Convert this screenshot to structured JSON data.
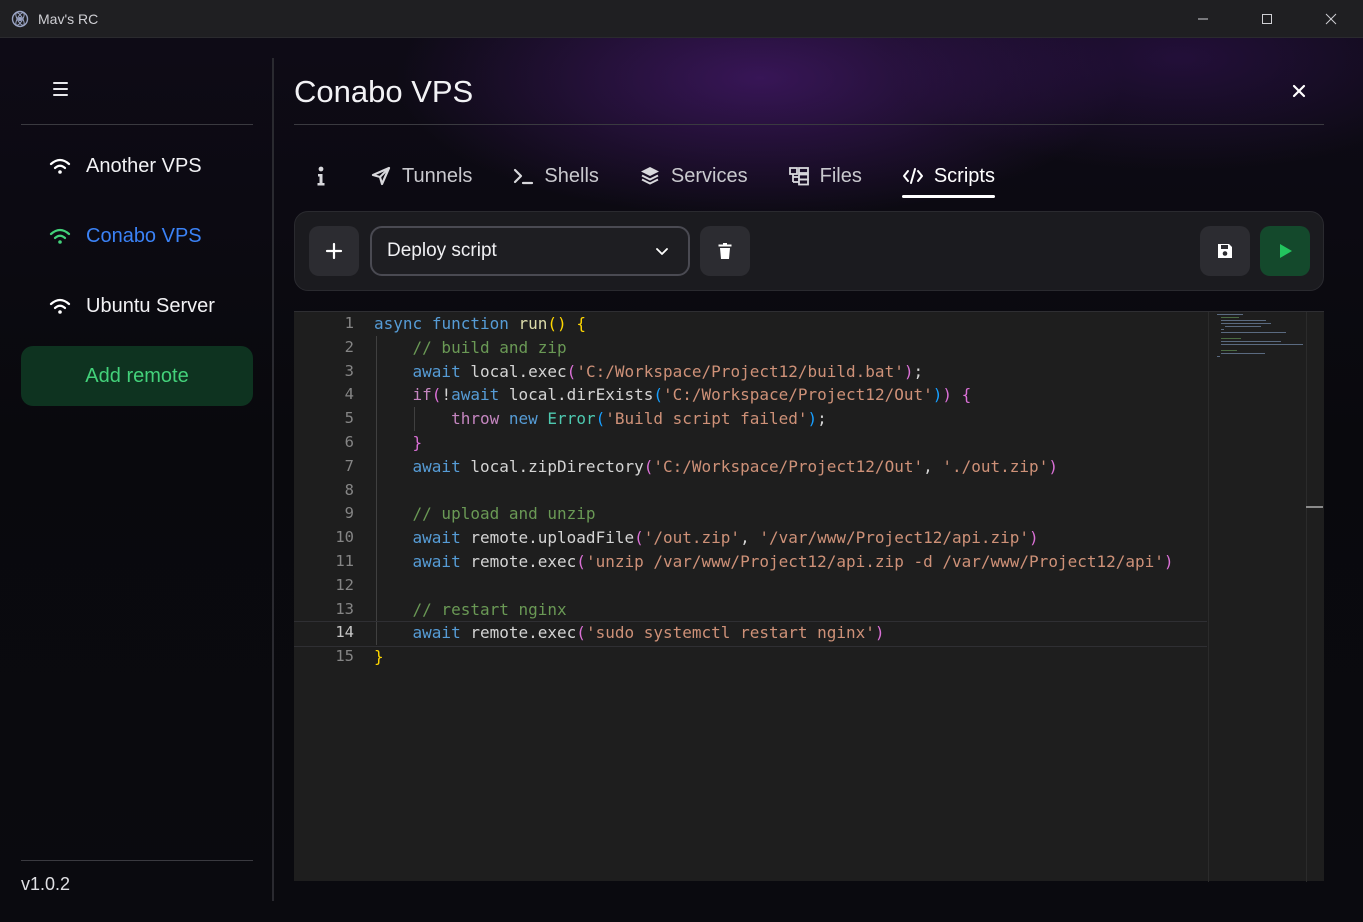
{
  "window": {
    "title": "Mav's RC"
  },
  "sidebar": {
    "remotes": [
      {
        "label": "Another VPS",
        "active": false
      },
      {
        "label": "Conabo VPS",
        "active": true
      },
      {
        "label": "Ubuntu Server",
        "active": false
      }
    ],
    "add_remote_label": "Add remote",
    "version": "v1.0.2"
  },
  "main": {
    "title": "Conabo VPS",
    "tabs": [
      {
        "label": "",
        "icon": "info-icon"
      },
      {
        "label": "Tunnels",
        "icon": "tunnels-icon"
      },
      {
        "label": "Shells",
        "icon": "terminal-icon"
      },
      {
        "label": "Services",
        "icon": "layers-icon"
      },
      {
        "label": "Files",
        "icon": "files-icon"
      },
      {
        "label": "Scripts",
        "icon": "code-icon",
        "active": true
      }
    ],
    "script_select": {
      "value": "Deploy script"
    }
  },
  "editor": {
    "current_line": 14,
    "line_numbers": [
      "1",
      "2",
      "3",
      "4",
      "5",
      "6",
      "7",
      "8",
      "9",
      "10",
      "11",
      "12",
      "13",
      "14",
      "15"
    ],
    "tokens": {
      "l1_async": "async",
      "l1_function": "function",
      "l1_run": "run",
      "l2": "// build and zip",
      "l3_await": "await",
      "l3_call": " local.exec",
      "l3_str": "'C:/Workspace/Project12/build.bat'",
      "l4_if": "if",
      "l4_await": "await",
      "l4_call": " local.dirExists",
      "l4_str": "'C:/Workspace/Project12/Out'",
      "l5_throw": "throw",
      "l5_new": "new",
      "l5_err": "Error",
      "l5_str": "'Build script failed'",
      "l7_await": "await",
      "l7_call": " local.zipDirectory",
      "l7_str1": "'C:/Workspace/Project12/Out'",
      "l7_str2": "'./out.zip'",
      "l9": "// upload and unzip",
      "l10_await": "await",
      "l10_call": " remote.uploadFile",
      "l10_str1": "'/out.zip'",
      "l10_str2": "'/var/www/Project12/api.zip'",
      "l11_await": "await",
      "l11_call": " remote.exec",
      "l11_str": "'unzip /var/www/Project12/api.zip -d /var/www/Project12/api'",
      "l13": "// restart nginx",
      "l14_await": "await",
      "l14_call": " remote.exec",
      "l14_str": "'sudo systemctl restart nginx'"
    }
  },
  "colors": {
    "active_remote": "#3b82f6",
    "active_wifi": "#43d17a",
    "add_remote_text": "#43d17a",
    "run_button": "#22c55e"
  }
}
